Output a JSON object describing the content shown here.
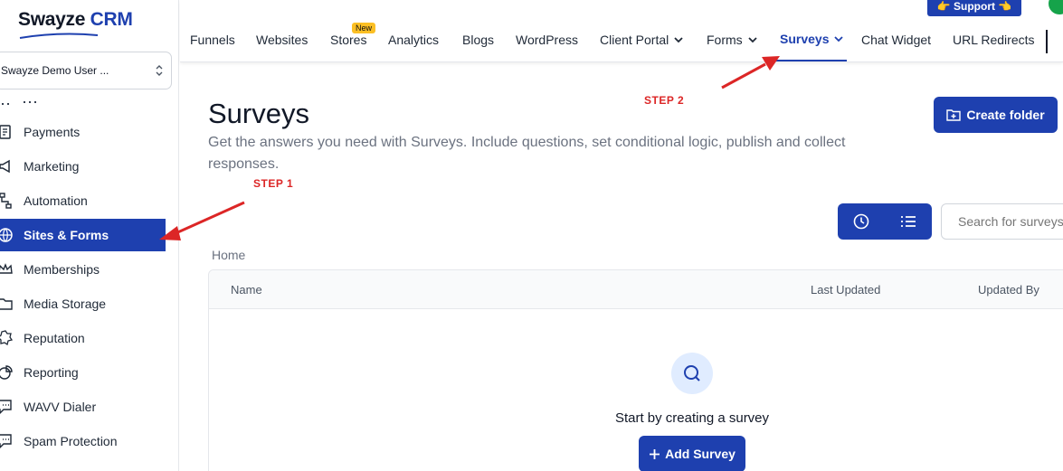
{
  "logo": {
    "brand_a": "Swayze",
    "brand_b": "CRM"
  },
  "account": {
    "name": "Swayze Demo User ..."
  },
  "sidebar": {
    "items": [
      {
        "label": "Payments",
        "icon": "receipt-icon"
      },
      {
        "label": "Marketing",
        "icon": "megaphone-icon"
      },
      {
        "label": "Automation",
        "icon": "flow-icon"
      },
      {
        "label": "Sites & Forms",
        "icon": "globe-icon",
        "active": true
      },
      {
        "label": "Memberships",
        "icon": "crown-icon"
      },
      {
        "label": "Media Storage",
        "icon": "folder-icon"
      },
      {
        "label": "Reputation",
        "icon": "badge-icon"
      },
      {
        "label": "Reporting",
        "icon": "pie-chart-icon"
      },
      {
        "label": "WAVV Dialer",
        "icon": "chat-icon"
      },
      {
        "label": "Spam Protection",
        "icon": "chat-icon"
      }
    ]
  },
  "topnav": {
    "items": [
      {
        "label": "Funnels"
      },
      {
        "label": "Websites"
      },
      {
        "label": "Stores",
        "badge": "New"
      },
      {
        "label": "Analytics"
      },
      {
        "label": "Blogs"
      },
      {
        "label": "WordPress"
      },
      {
        "label": "Client Portal",
        "dropdown": true
      },
      {
        "label": "Forms",
        "dropdown": true
      },
      {
        "label": "Surveys",
        "dropdown": true,
        "active": true
      },
      {
        "label": "Chat Widget"
      },
      {
        "label": "URL Redirects"
      }
    ],
    "support_label": "👉 Support 👈"
  },
  "page": {
    "title": "Surveys",
    "subtitle": "Get the answers you need with Surveys. Include questions, set conditional logic, publish and collect responses.",
    "create_folder_label": "Create folder",
    "search_placeholder": "Search for surveys",
    "breadcrumb": "Home",
    "table_columns": [
      "Name",
      "Last Updated",
      "Updated By"
    ],
    "empty_text": "Start by creating a survey",
    "add_survey_label": "Add Survey"
  },
  "annotations": {
    "step1": "STEP 1",
    "step2": "STEP 2",
    "color": "#dc2626"
  },
  "colors": {
    "primary": "#1e40af",
    "badge": "#fbbf24"
  }
}
